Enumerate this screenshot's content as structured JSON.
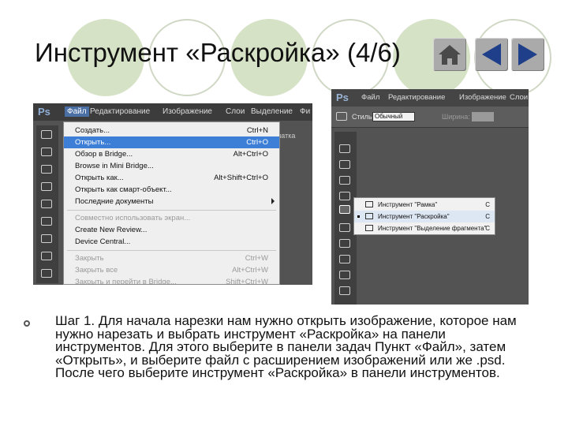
{
  "slide": {
    "title": "Инструмент «Раскройка» (4/6)",
    "nav": {
      "home_icon": "home-icon",
      "prev_icon": "triangle-left-icon",
      "next_icon": "triangle-right-icon"
    },
    "body_text": "Шаг 1. Для начала нарезки нам нужно открыть изображение, которое нам нужно нарезать и выбрать инструмент «Раскройка» на панели инструментов. Для этого выберите в панели задач Пункт «Файл», затем «Открыть», и выберите файл с расширением изображений или же .psd. После чего выберите инструмент «Раскройка» в панели инструментов."
  },
  "screenshot1": {
    "logo": "Ps",
    "menubar": [
      "Файл",
      "Редактирование",
      "Изображение",
      "Слои",
      "Выделение",
      "Фи"
    ],
    "options_fragment": "печатка",
    "file_menu": [
      {
        "label": "Создать...",
        "shortcut": "Ctrl+N"
      },
      {
        "label": "Открыть...",
        "shortcut": "Ctrl+O"
      },
      {
        "label": "Обзор в Bridge...",
        "shortcut": "Alt+Ctrl+O"
      },
      {
        "label": "Browse in Mini Bridge...",
        "shortcut": ""
      },
      {
        "label": "Открыть как...",
        "shortcut": "Alt+Shift+Ctrl+O"
      },
      {
        "label": "Открыть как смарт-объект...",
        "shortcut": ""
      },
      {
        "label": "Последние документы",
        "shortcut": ""
      },
      {
        "label": "Совместно использовать экран...",
        "shortcut": ""
      },
      {
        "label": "Create New Review...",
        "shortcut": ""
      },
      {
        "label": "Device Central...",
        "shortcut": ""
      },
      {
        "label": "Закрыть",
        "shortcut": "Ctrl+W"
      },
      {
        "label": "Закрыть все",
        "shortcut": "Alt+Ctrl+W"
      },
      {
        "label": "Закрыть и перейти в Bridge...",
        "shortcut": "Shift+Ctrl+W"
      }
    ]
  },
  "screenshot2": {
    "logo": "Ps",
    "menubar": [
      "Файл",
      "Редактирование",
      "Изображение",
      "Слои"
    ],
    "options": {
      "style_label": "Стиль:",
      "style_value": "Обычный",
      "width_label": "Ширина:"
    },
    "flyout": [
      {
        "label": "Инструмент \"Рамка\"",
        "key": "C"
      },
      {
        "label": "Инструмент \"Раскройка\"",
        "key": "C"
      },
      {
        "label": "Инструмент \"Выделение фрагмента\"",
        "key": "C"
      }
    ]
  }
}
